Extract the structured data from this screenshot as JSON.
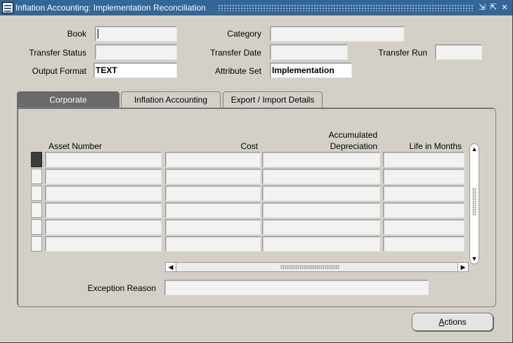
{
  "window": {
    "title": "Inflation Accounting: Implementation Reconciliation",
    "controls": {
      "minimize": "⇲",
      "maximize": "⇱",
      "close": "×"
    }
  },
  "header": {
    "book": {
      "label": "Book",
      "value": ""
    },
    "category": {
      "label": "Category",
      "value": ""
    },
    "transfer_status": {
      "label": "Transfer Status",
      "value": ""
    },
    "transfer_date": {
      "label": "Transfer Date",
      "value": ""
    },
    "transfer_run": {
      "label": "Transfer Run",
      "value": ""
    },
    "output_format": {
      "label": "Output Format",
      "value": "TEXT"
    },
    "attribute_set": {
      "label": "Attribute Set",
      "value": "Implementation"
    }
  },
  "tabs": [
    {
      "label": "Corporate",
      "active": true
    },
    {
      "label": "Inflation Accounting",
      "active": false
    },
    {
      "label": "Export / Import Details",
      "active": false
    }
  ],
  "table": {
    "columns": {
      "asset_number": "Asset Number",
      "cost": "Cost",
      "accum_line1": "Accumulated",
      "accum_line2": "Depreciation",
      "life": "Life in Months"
    },
    "rows": [
      {
        "asset_number": "",
        "cost": "",
        "accumulated_depreciation": "",
        "life_in_months": ""
      },
      {
        "asset_number": "",
        "cost": "",
        "accumulated_depreciation": "",
        "life_in_months": ""
      },
      {
        "asset_number": "",
        "cost": "",
        "accumulated_depreciation": "",
        "life_in_months": ""
      },
      {
        "asset_number": "",
        "cost": "",
        "accumulated_depreciation": "",
        "life_in_months": ""
      },
      {
        "asset_number": "",
        "cost": "",
        "accumulated_depreciation": "",
        "life_in_months": ""
      },
      {
        "asset_number": "",
        "cost": "",
        "accumulated_depreciation": "",
        "life_in_months": ""
      }
    ]
  },
  "exception_reason": {
    "label": "Exception Reason",
    "value": ""
  },
  "actions_button": {
    "mnemonic": "A",
    "rest": "ctions"
  },
  "icons": [
    "app-icon",
    "minimize-icon",
    "maximize-icon",
    "close-icon",
    "scroll-up-icon",
    "scroll-down-icon",
    "scroll-left-icon",
    "scroll-right-icon"
  ]
}
